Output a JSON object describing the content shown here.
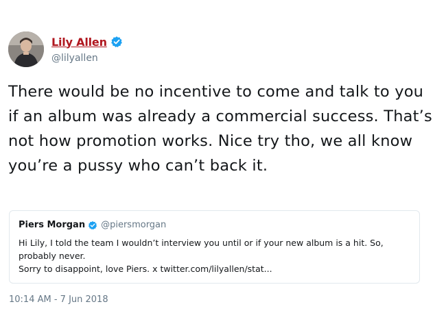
{
  "author": {
    "display_name": "Lily Allen",
    "handle": "@lilyallen",
    "verified": true,
    "name_color": "#b0171f"
  },
  "tweet": {
    "text": "There would be no incentive to come and talk to you if an album was already a commercial success. That’s not how promotion works. Nice try tho, we all know you’re a pussy who can’t back it.",
    "timestamp": "10:14 AM - 7 Jun 2018"
  },
  "quoted_tweet": {
    "display_name": "Piers Morgan",
    "handle": "@piersmorgan",
    "verified": true,
    "text_line1": "Hi Lily, I told the team I wouldn’t interview you until or if your new album is a hit. So, probably never.",
    "text_line2": "Sorry to disappoint, love Piers. x twitter.com/lilyallen/stat..."
  },
  "colors": {
    "verified_blue": "#1da1f2",
    "secondary_text": "#657786",
    "border": "#e1e8ed"
  },
  "icons": {
    "avatar": "profile-photo",
    "verified": "verified-badge-icon"
  }
}
